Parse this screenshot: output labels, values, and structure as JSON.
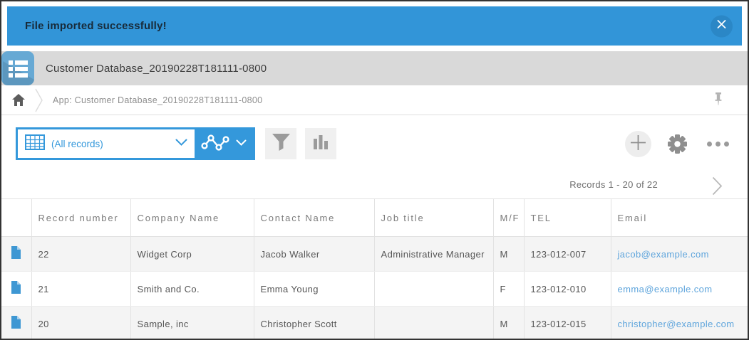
{
  "banner": {
    "message": "File imported successfully!",
    "close_icon": "x-icon"
  },
  "app_header": {
    "title": "Customer Database_20190228T181111-0800",
    "icon": "list-app-icon"
  },
  "breadcrumb": {
    "home_icon": "home-icon",
    "text": "App: Customer Database_20190228T181111-0800",
    "pin_icon": "pin-icon"
  },
  "toolbar": {
    "view_selector": {
      "value": "(All records)",
      "icon": "table-grid-icon"
    },
    "graph_button": {
      "icon": "line-graph-icon"
    },
    "filter_button": {
      "icon": "funnel-icon"
    },
    "chart_button": {
      "icon": "bar-chart-icon"
    },
    "add_button": {
      "icon": "plus-icon"
    },
    "settings_button": {
      "icon": "gear-icon"
    },
    "more_button": {
      "icon": "ellipsis-icon"
    }
  },
  "pagination": {
    "label": "Records 1 - 20 of 22",
    "next_icon": "chevron-right-icon"
  },
  "table": {
    "columns": [
      "Record number",
      "Company Name",
      "Contact Name",
      "Job title",
      "M/F",
      "TEL",
      "Email"
    ],
    "rows": [
      {
        "record_number": "22",
        "company": "Widget Corp",
        "contact": "Jacob Walker",
        "job_title": "Administrative Manager",
        "mf": "M",
        "tel": "123-012-007",
        "email": "jacob@example.com"
      },
      {
        "record_number": "21",
        "company": "Smith and Co.",
        "contact": "Emma Young",
        "job_title": "",
        "mf": "F",
        "tel": "123-012-010",
        "email": "emma@example.com"
      },
      {
        "record_number": "20",
        "company": "Sample, inc",
        "contact": "Christopher Scott",
        "job_title": "",
        "mf": "M",
        "tel": "123-012-015",
        "email": "christopher@example.com"
      }
    ]
  },
  "colors": {
    "banner_blue": "#3295d8",
    "accent_blue": "#3498db",
    "link_blue": "#5fa5dc",
    "header_gray": "#d9d9d9",
    "row_shade": "#f4f4f4"
  }
}
